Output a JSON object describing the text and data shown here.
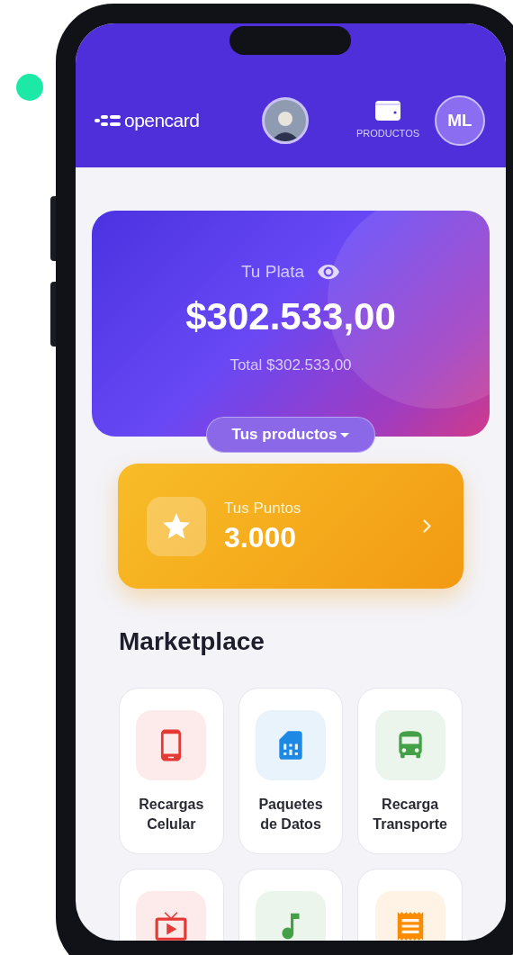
{
  "header": {
    "logo": "opencard",
    "products_label": "PRODUCTOS",
    "user_initials": "ML"
  },
  "balance_card": {
    "label": "Tu Plata",
    "amount": "$302.533,00",
    "total": "Total $302.533,00",
    "products_button": "Tus productos"
  },
  "points_card": {
    "label": "Tus Puntos",
    "value": "3.000"
  },
  "marketplace": {
    "title": "Marketplace",
    "items": [
      {
        "kind": "phone",
        "label": "Recargas Celular",
        "color": "#e53935"
      },
      {
        "kind": "sim",
        "label": "Paquetes de Datos",
        "color": "#1e88e5"
      },
      {
        "kind": "bus",
        "label": "Recarga Transporte",
        "color": "#43a047"
      },
      {
        "kind": "tv",
        "color": "#e53935"
      },
      {
        "kind": "music",
        "color": "#43a047"
      },
      {
        "kind": "receipt",
        "color": "#fb8c00"
      }
    ]
  }
}
